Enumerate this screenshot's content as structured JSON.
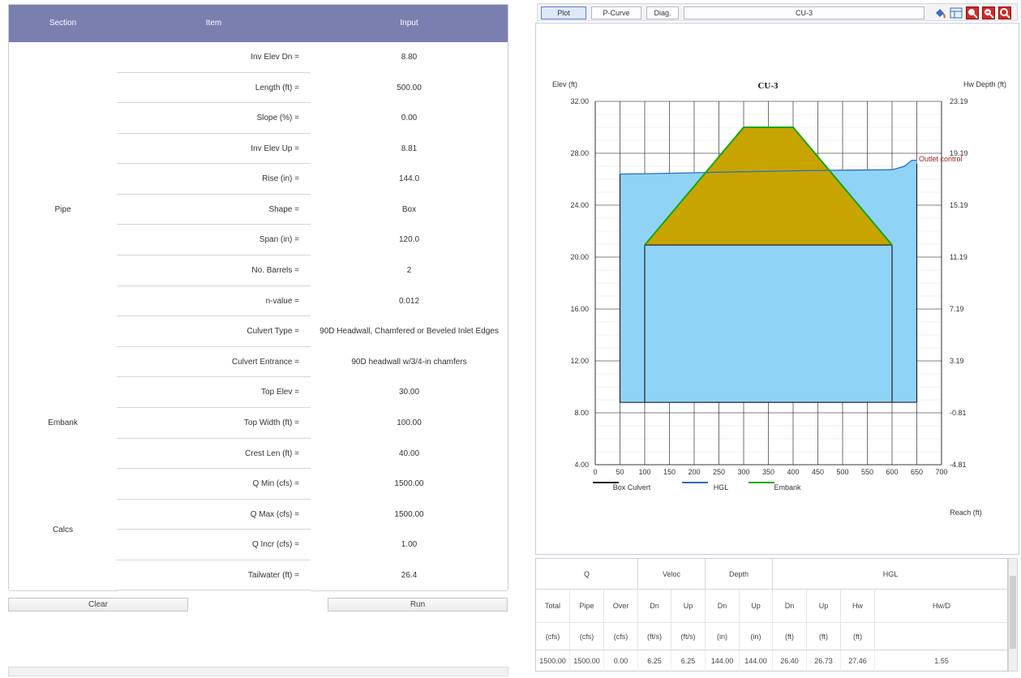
{
  "left_table": {
    "headers": {
      "section": "Section",
      "item": "Item",
      "input": "Input"
    },
    "sections": [
      {
        "name": "Pipe"
      },
      {
        "name": "Embank"
      },
      {
        "name": "Calcs"
      }
    ],
    "rows": [
      {
        "item": "Inv Elev Dn =",
        "input": "8.80"
      },
      {
        "item": "Length (ft) =",
        "input": "500.00"
      },
      {
        "item": "Slope (%) =",
        "input": "0.00"
      },
      {
        "item": "Inv Elev Up =",
        "input": "8.81"
      },
      {
        "item": "Rise (in) =",
        "input": "144.0"
      },
      {
        "item": "Shape =",
        "input": "Box"
      },
      {
        "item": "Span (in) =",
        "input": "120.0"
      },
      {
        "item": "No. Barrels =",
        "input": "2"
      },
      {
        "item": "n-value =",
        "input": "0.012"
      },
      {
        "item": "Culvert Type =",
        "input": "90D Headwall, Chamfered or Beveled Inlet Edges"
      },
      {
        "item": "Culvert Entrance =",
        "input": "90D headwall w/3/4-in chamfers"
      },
      {
        "item": "Top Elev =",
        "input": "30.00"
      },
      {
        "item": "Top Width (ft) =",
        "input": "100.00"
      },
      {
        "item": "Crest Len (ft) =",
        "input": "40.00"
      },
      {
        "item": "Q Min (cfs) =",
        "input": "1500.00"
      },
      {
        "item": "Q Max (cfs) =",
        "input": "1500.00"
      },
      {
        "item": "Q Incr (cfs) =",
        "input": "1.00"
      },
      {
        "item": "Tailwater (ft) =",
        "input": "26.4"
      }
    ]
  },
  "buttons": {
    "clear": "Clear",
    "run": "Run"
  },
  "toolbar": {
    "tabs": [
      "Plot",
      "P-Curve",
      "Diag."
    ],
    "title": "CU-3"
  },
  "chart_data": {
    "type": "line",
    "title": "CU-3",
    "ylabel": "Elev (ft)",
    "y2label": "Hw Depth (ft)",
    "xlabel": "Reach (ft)",
    "xlim": [
      0,
      700
    ],
    "ylim": [
      4,
      32
    ],
    "xticks": [
      "0",
      "50",
      "100",
      "150",
      "200",
      "250",
      "300",
      "350",
      "400",
      "450",
      "500",
      "550",
      "600",
      "650",
      "700"
    ],
    "yticks": [
      "4.00",
      "8.00",
      "12.00",
      "16.00",
      "20.00",
      "24.00",
      "28.00",
      "32.00"
    ],
    "y2ticks": [
      "-4.81",
      "-0.81",
      "3.19",
      "7.19",
      "11.19",
      "15.19",
      "19.19",
      "23.19"
    ],
    "annotation": "Outlet control",
    "colors": {
      "water": "#8fd3f7",
      "embank_fill": "#c8a400",
      "embank_line": "#13a613",
      "hgl": "#2b6cc4",
      "culvert": "#222222",
      "annotation": "#9b1b1b"
    },
    "legend": [
      "Box Culvert",
      "HGL",
      "Embank"
    ],
    "series": [
      {
        "name": "Box Culvert",
        "x": [
          50,
          50,
          650,
          650,
          100,
          100,
          600,
          600
        ],
        "y": [
          26.4,
          8.8,
          8.81,
          27.2,
          20.93,
          8.8,
          8.81,
          20.93
        ]
      },
      {
        "name": "HGL",
        "x": [
          50,
          100,
          200,
          300,
          400,
          500,
          600,
          625,
          640,
          650
        ],
        "y": [
          26.4,
          26.42,
          26.5,
          26.58,
          26.65,
          26.7,
          26.73,
          27.0,
          27.46,
          27.46
        ]
      },
      {
        "name": "Embank",
        "x": [
          100,
          300,
          400,
          600
        ],
        "y": [
          20.93,
          30.0,
          30.0,
          20.93
        ]
      }
    ]
  },
  "results": {
    "group_headers": [
      "Q",
      "Veloc",
      "Depth",
      "HGL"
    ],
    "sub_headers": [
      "Total",
      "Pipe",
      "Over",
      "Dn",
      "Up",
      "Dn",
      "Up",
      "Dn",
      "Up",
      "Hw",
      "Hw/D"
    ],
    "units": [
      "(cfs)",
      "(cfs)",
      "(cfs)",
      "(ft/s)",
      "(ft/s)",
      "(in)",
      "(in)",
      "(ft)",
      "(ft)",
      "(ft)",
      ""
    ],
    "values": [
      "1500.00",
      "1500.00",
      "0.00",
      "6.25",
      "6.25",
      "144.00",
      "144.00",
      "26.40",
      "26.73",
      "27.46",
      "1.55"
    ]
  }
}
